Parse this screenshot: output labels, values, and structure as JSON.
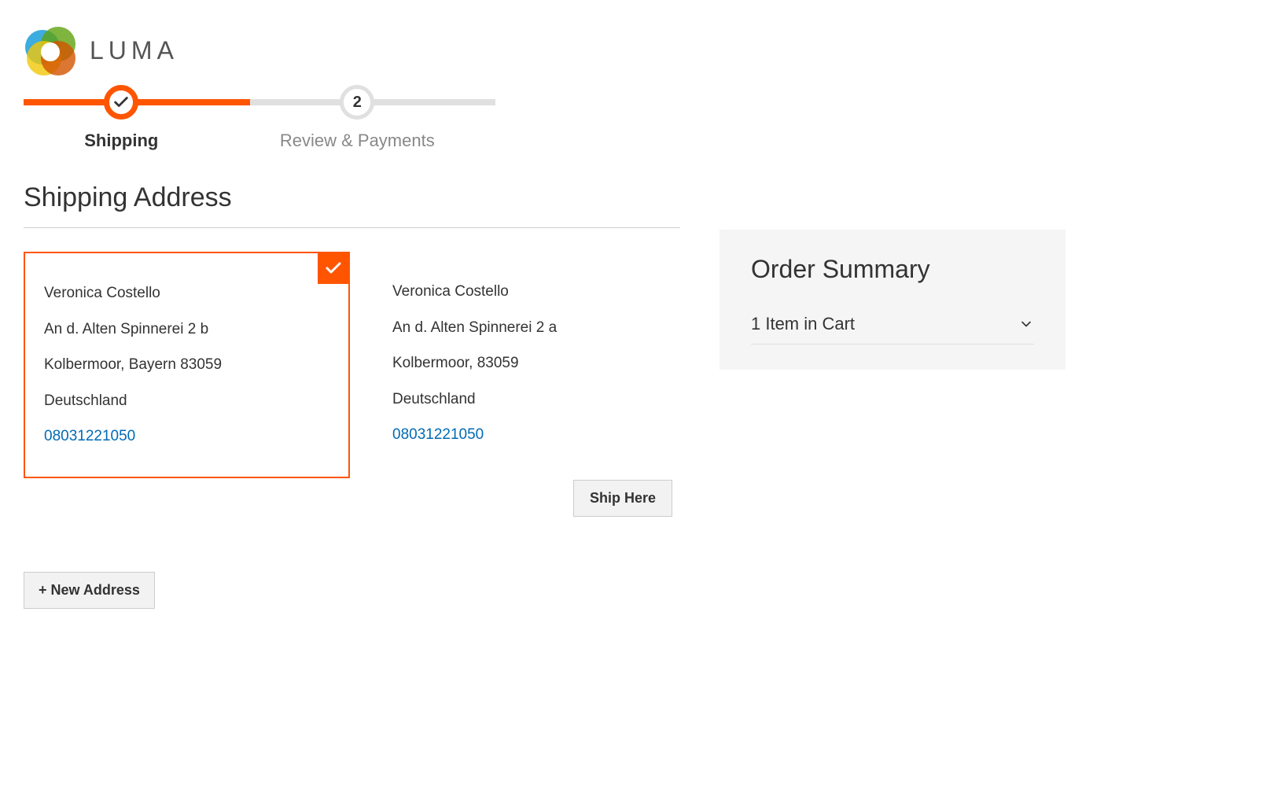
{
  "brand": {
    "name": "LUMA"
  },
  "progress": {
    "steps": [
      {
        "label": "Shipping",
        "active": true
      },
      {
        "label": "Review & Payments",
        "active": false,
        "number": "2"
      }
    ]
  },
  "page": {
    "title": "Shipping Address"
  },
  "addresses": [
    {
      "selected": true,
      "name": "Veronica Costello",
      "street": "An d. Alten Spinnerei 2 b",
      "city_line": "Kolbermoor, Bayern 83059",
      "country": "Deutschland",
      "phone": "08031221050"
    },
    {
      "selected": false,
      "name": "Veronica Costello",
      "street": "An d. Alten Spinnerei 2 a",
      "city_line": "Kolbermoor, 83059",
      "country": "Deutschland",
      "phone": "08031221050"
    }
  ],
  "buttons": {
    "ship_here": "Ship Here",
    "new_address": "+ New Address"
  },
  "summary": {
    "title": "Order Summary",
    "cart_line": "1 Item in Cart"
  }
}
